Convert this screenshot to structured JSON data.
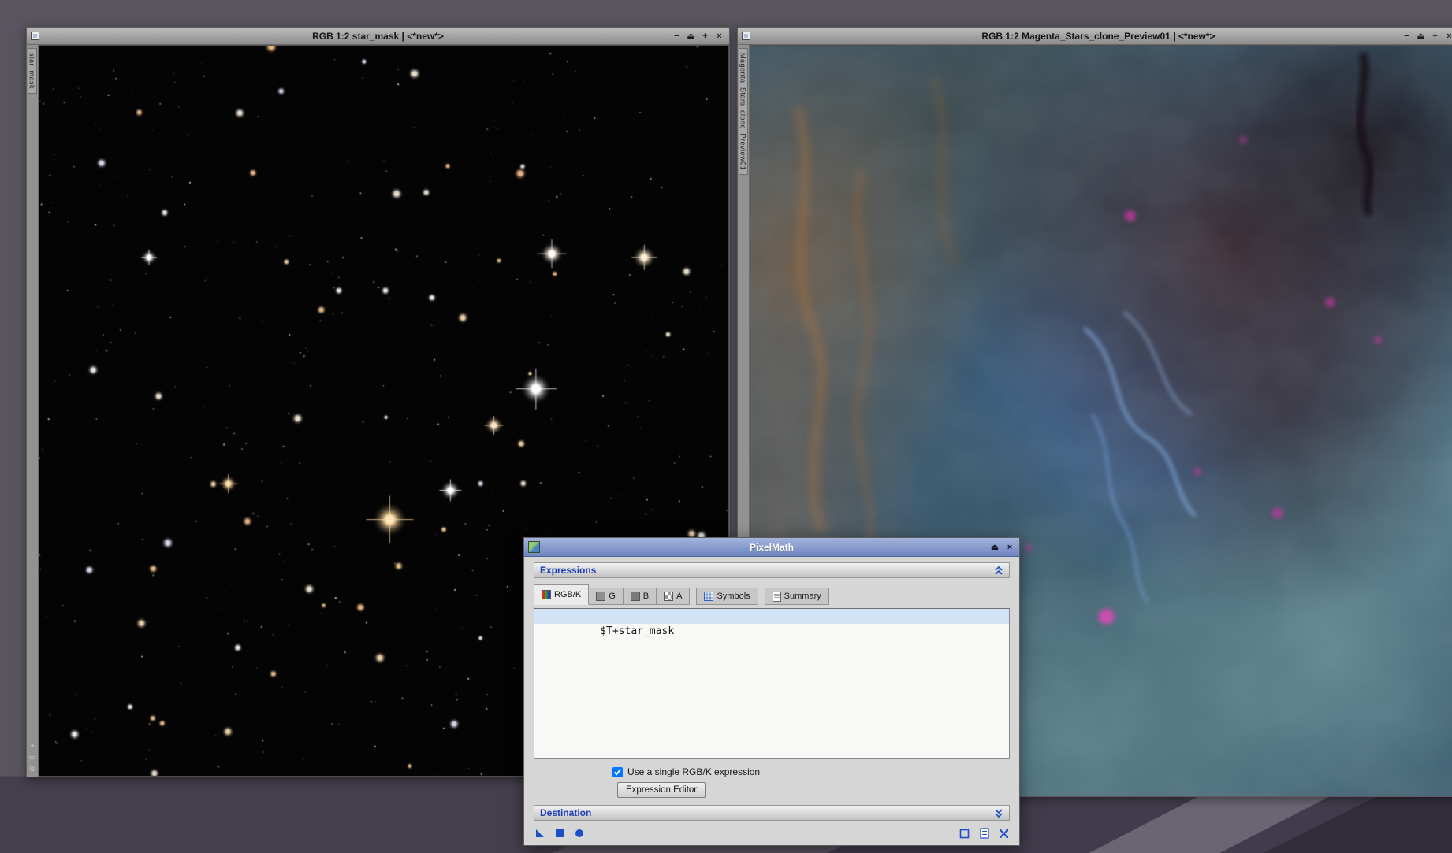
{
  "desktop": {
    "bg": "#59545e"
  },
  "windows": {
    "left": {
      "title": "RGB 1:2 star_mask | <*new*>",
      "tab": "star_mask",
      "zoom_ratio": "1:2"
    },
    "right": {
      "title": "RGB 1:2 Magenta_Stars_clone_Preview01 | <*new*>",
      "tab": "Magenta_Stars_clone_Preview01",
      "zoom_ratio": "1:2"
    }
  },
  "icons": {
    "minimize": "−",
    "shade": "⏏",
    "zoom": "+",
    "close": "×",
    "crosshair": "+",
    "frame": "▭",
    "target": "◎"
  },
  "pixelmath": {
    "title": "PixelMath",
    "sections": {
      "expressions": "Expressions",
      "destination": "Destination"
    },
    "tabs": [
      "RGB/K",
      "G",
      "B",
      "A",
      "Symbols",
      "Summary"
    ],
    "active_tab": "RGB/K",
    "expression": "$T+star_mask",
    "single_rgbk_label": "Use a single RGB/K expression",
    "single_rgbk_checked": "checked",
    "expression_editor_button": "Expression Editor",
    "accent_blue": "#1c50c8",
    "titlebar_blue": "#6e86c0"
  }
}
